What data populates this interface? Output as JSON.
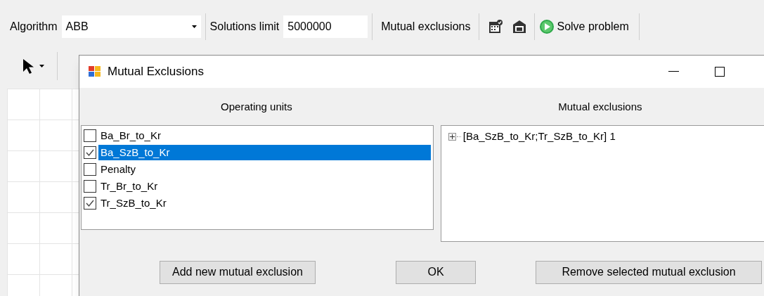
{
  "toolbar": {
    "algorithm_label": "Algorithm",
    "algorithm_value": "ABB",
    "solutions_limit_label": "Solutions limit",
    "solutions_limit_value": "5000000",
    "mutual_exclusions_button": "Mutual exclusions",
    "solve_button": "Solve problem"
  },
  "dialog": {
    "title": "Mutual Exclusions",
    "operating_units_heading": "Operating units",
    "mutual_exclusions_heading": "Mutual exclusions",
    "operating_units": [
      {
        "label": "Ba_Br_to_Kr",
        "checked": false,
        "selected": false
      },
      {
        "label": "Ba_SzB_to_Kr",
        "checked": true,
        "selected": true
      },
      {
        "label": "Penalty",
        "checked": false,
        "selected": false
      },
      {
        "label": "Tr_Br_to_Kr",
        "checked": false,
        "selected": false
      },
      {
        "label": "Tr_SzB_to_Kr",
        "checked": true,
        "selected": false
      }
    ],
    "mutual_exclusions": [
      {
        "label": "[Ba_SzB_to_Kr;Tr_SzB_to_Kr] 1",
        "expanded": false
      }
    ],
    "buttons": [
      "Add new mutual exclusion",
      "OK",
      "Remove selected mutual exclusion"
    ]
  }
}
